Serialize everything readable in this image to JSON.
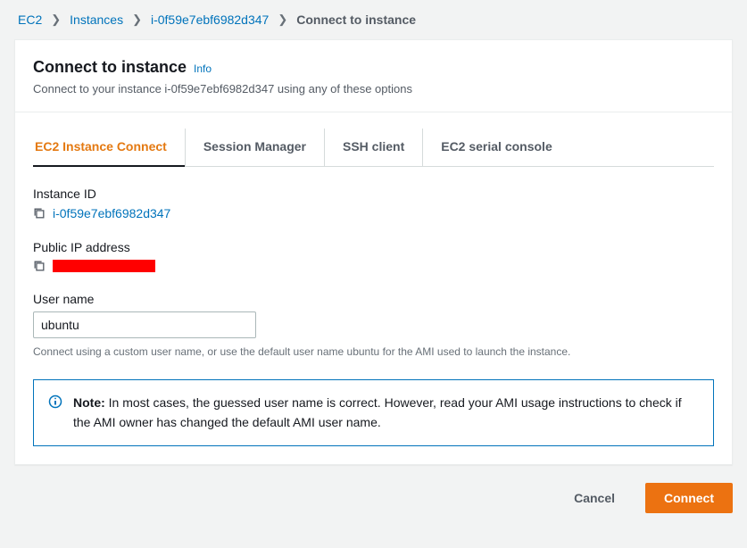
{
  "breadcrumb": {
    "items": [
      {
        "label": "EC2",
        "link": true
      },
      {
        "label": "Instances",
        "link": true
      },
      {
        "label": "i-0f59e7ebf6982d347",
        "link": true
      },
      {
        "label": "Connect to instance",
        "link": false
      }
    ]
  },
  "header": {
    "title": "Connect to instance",
    "info": "Info",
    "subtitle": "Connect to your instance i-0f59e7ebf6982d347 using any of these options"
  },
  "tabs": [
    {
      "label": "EC2 Instance Connect",
      "active": true
    },
    {
      "label": "Session Manager",
      "active": false
    },
    {
      "label": "SSH client",
      "active": false
    },
    {
      "label": "EC2 serial console",
      "active": false
    }
  ],
  "fields": {
    "instance_id": {
      "label": "Instance ID",
      "value": "i-0f59e7ebf6982d347"
    },
    "public_ip": {
      "label": "Public IP address",
      "redacted": true
    },
    "user_name": {
      "label": "User name",
      "value": "ubuntu",
      "help": "Connect using a custom user name, or use the default user name ubuntu for the AMI used to launch the instance."
    }
  },
  "note": {
    "bold": "Note:",
    "text": " In most cases, the guessed user name is correct. However, read your AMI usage instructions to check if the AMI owner has changed the default AMI user name."
  },
  "footer": {
    "cancel": "Cancel",
    "connect": "Connect"
  }
}
